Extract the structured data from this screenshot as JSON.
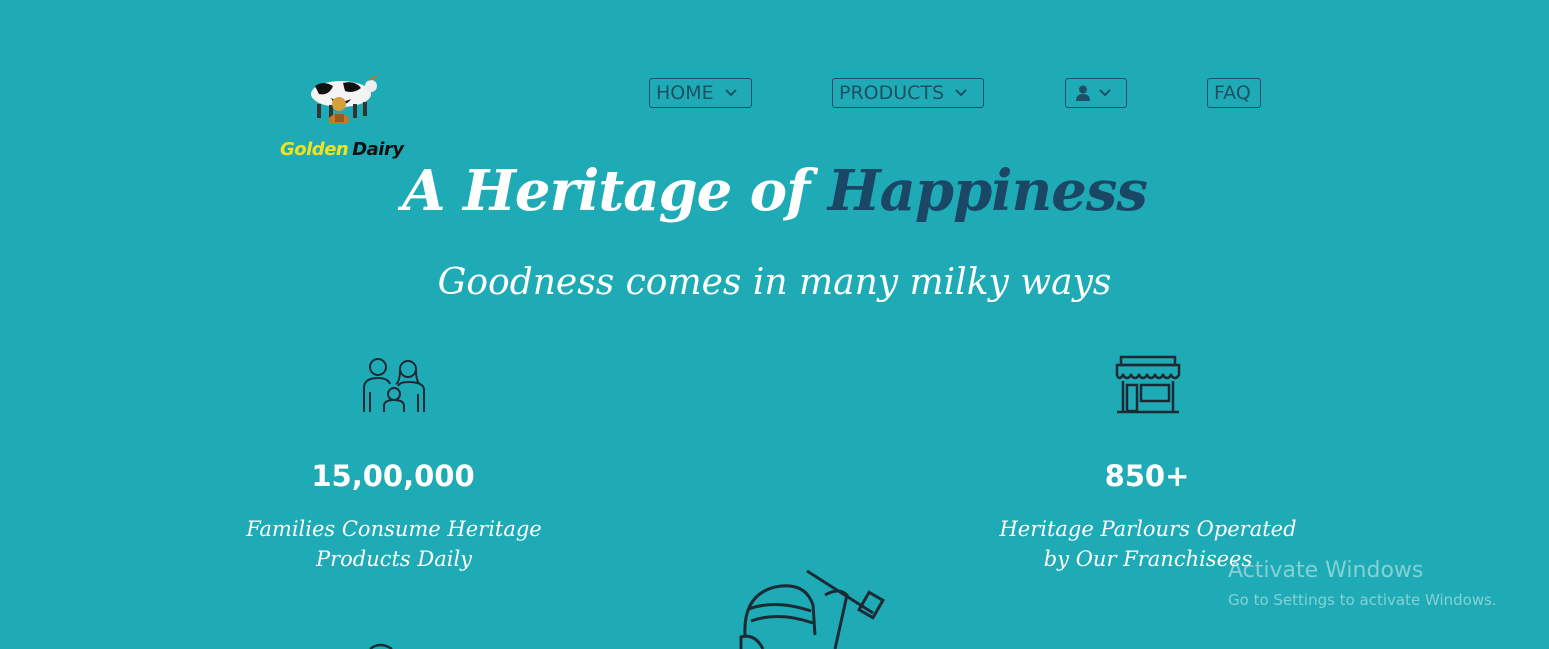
{
  "brand": {
    "word1": "Golden",
    "word2": "Dairy",
    "logo_icon": "cow-farmer-logo-icon"
  },
  "nav": {
    "home_label": "HOME",
    "products_label": "PRODUCTS",
    "faq_label": "FAQ",
    "user_icon": "user-icon",
    "dropdown_icon": "chevron-down-icon"
  },
  "hero": {
    "title_part1": "A Heritage of",
    "title_part2": "Happiness",
    "subtitle": "Goodness comes in many milky ways"
  },
  "stats": [
    {
      "icon": "family-icon",
      "value": "15,00,000",
      "caption_line1": "Families Consume Heritage",
      "caption_line2": "Products Daily"
    },
    {
      "icon": "store-icon",
      "value": "850+",
      "caption_line1": "Heritage Parlours Operated",
      "caption_line2": "by Our Franchisees"
    }
  ],
  "watermark": {
    "line1": "Activate Windows",
    "line2": "Go to Settings to activate Windows."
  },
  "colors": {
    "background": "#1fabb5",
    "accent": "#1b4767",
    "brand_yellow": "#f3e21c"
  }
}
